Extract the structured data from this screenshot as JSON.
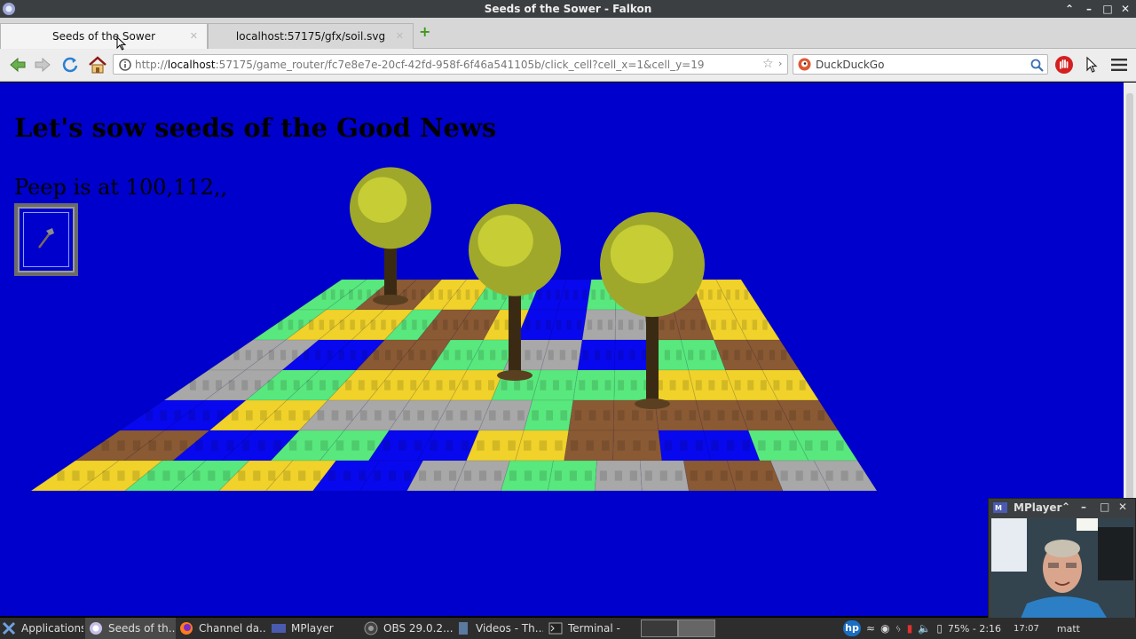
{
  "window": {
    "title": "Seeds of the Sower - Falkon",
    "controls": [
      "⌃",
      "–",
      "□",
      "✕"
    ]
  },
  "tabs": [
    {
      "label": "Seeds of the Sower",
      "active": true
    },
    {
      "label": "localhost:57175/gfx/soil.svg",
      "active": false
    }
  ],
  "toolbar": {
    "url_prefix": "http://",
    "url_host": "localhost",
    "url_rest": ":57175/game_router/fc7e8e7e-20cf-42fd-958f-6f46a541105b/click_cell?cell_x=1&cell_y=19",
    "search_placeholder": "DuckDuckGo"
  },
  "page": {
    "heading": "Let's sow seeds of the Good News",
    "status": "Peep is at 100,112,,",
    "background": "#0000cc"
  },
  "mplayer": {
    "title": "MPlayer"
  },
  "taskbar": {
    "items": [
      {
        "label": "Applications",
        "icon": "x-logo-icon"
      },
      {
        "label": "Seeds of th...",
        "icon": "falkon-icon",
        "active": true
      },
      {
        "label": "Channel da...",
        "icon": "firefox-icon"
      },
      {
        "label": "MPlayer",
        "icon": "mplayer-icon"
      },
      {
        "label": "OBS 29.0.2...",
        "icon": "obs-icon"
      },
      {
        "label": "Videos - Th...",
        "icon": "file-manager-icon"
      },
      {
        "label": "Terminal -",
        "icon": "terminal-icon"
      }
    ],
    "battery": "75% - 2:16",
    "clock": "17:07",
    "user": "matt"
  },
  "colors": {
    "grass": "#59e87d",
    "sand": "#f0d22a",
    "soil": "#8a5a35",
    "stone": "#a8a8a8",
    "water": "#0808ee"
  }
}
